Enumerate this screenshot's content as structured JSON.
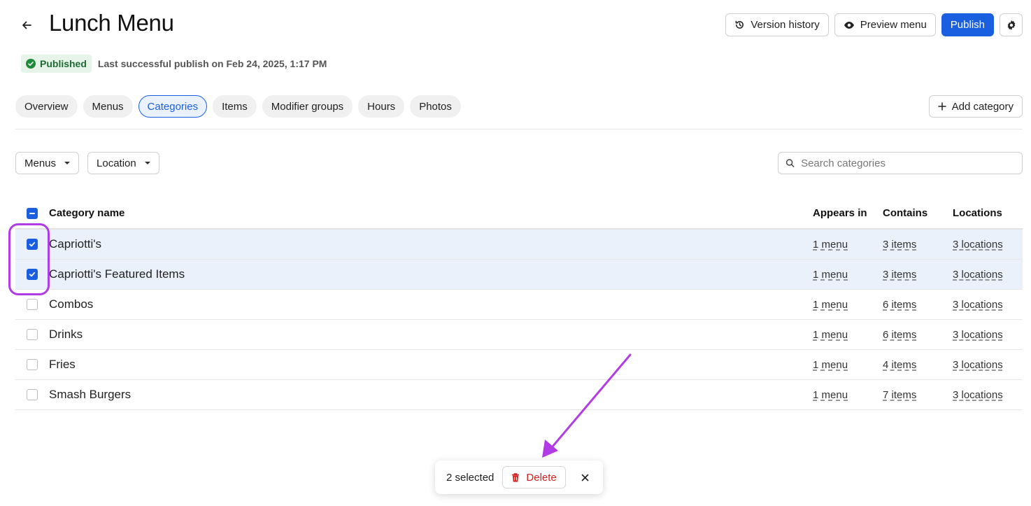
{
  "header": {
    "title": "Lunch Menu",
    "back_icon": "arrow-left-icon",
    "version_history_label": "Version history",
    "preview_menu_label": "Preview menu",
    "publish_label": "Publish",
    "settings_icon": "gear-icon"
  },
  "status": {
    "badge_label": "Published",
    "last_publish_text": "Last successful publish on Feb 24, 2025, 1:17 PM"
  },
  "tabs": [
    {
      "label": "Overview",
      "active": false
    },
    {
      "label": "Menus",
      "active": false
    },
    {
      "label": "Categories",
      "active": true
    },
    {
      "label": "Items",
      "active": false
    },
    {
      "label": "Modifier groups",
      "active": false
    },
    {
      "label": "Hours",
      "active": false
    },
    {
      "label": "Photos",
      "active": false
    }
  ],
  "add_category_label": "Add category",
  "filters": {
    "menus_label": "Menus",
    "location_label": "Location",
    "search_placeholder": "Search categories"
  },
  "table": {
    "columns": {
      "name": "Category name",
      "appears_in": "Appears in",
      "contains": "Contains",
      "locations": "Locations"
    },
    "rows": [
      {
        "name": "Capriotti's",
        "appears_in": "1 menu",
        "contains": "3 items",
        "locations": "3 locations",
        "selected": true
      },
      {
        "name": "Capriotti's Featured Items",
        "appears_in": "1 menu",
        "contains": "3 items",
        "locations": "3 locations",
        "selected": true
      },
      {
        "name": "Combos",
        "appears_in": "1 menu",
        "contains": "6 items",
        "locations": "3 locations",
        "selected": false
      },
      {
        "name": "Drinks",
        "appears_in": "1 menu",
        "contains": "6 items",
        "locations": "3 locations",
        "selected": false
      },
      {
        "name": "Fries",
        "appears_in": "1 menu",
        "contains": "4 items",
        "locations": "3 locations",
        "selected": false
      },
      {
        "name": "Smash Burgers",
        "appears_in": "1 menu",
        "contains": "7 items",
        "locations": "3 locations",
        "selected": false
      }
    ]
  },
  "action_bar": {
    "selected_text": "2 selected",
    "delete_label": "Delete"
  },
  "colors": {
    "primary": "#1a5fe0",
    "selected_row": "#eaf1fb",
    "published_bg": "#e7f4ea",
    "published_fg": "#1e6b33",
    "danger": "#d32020",
    "annotation": "#b13ce6"
  }
}
